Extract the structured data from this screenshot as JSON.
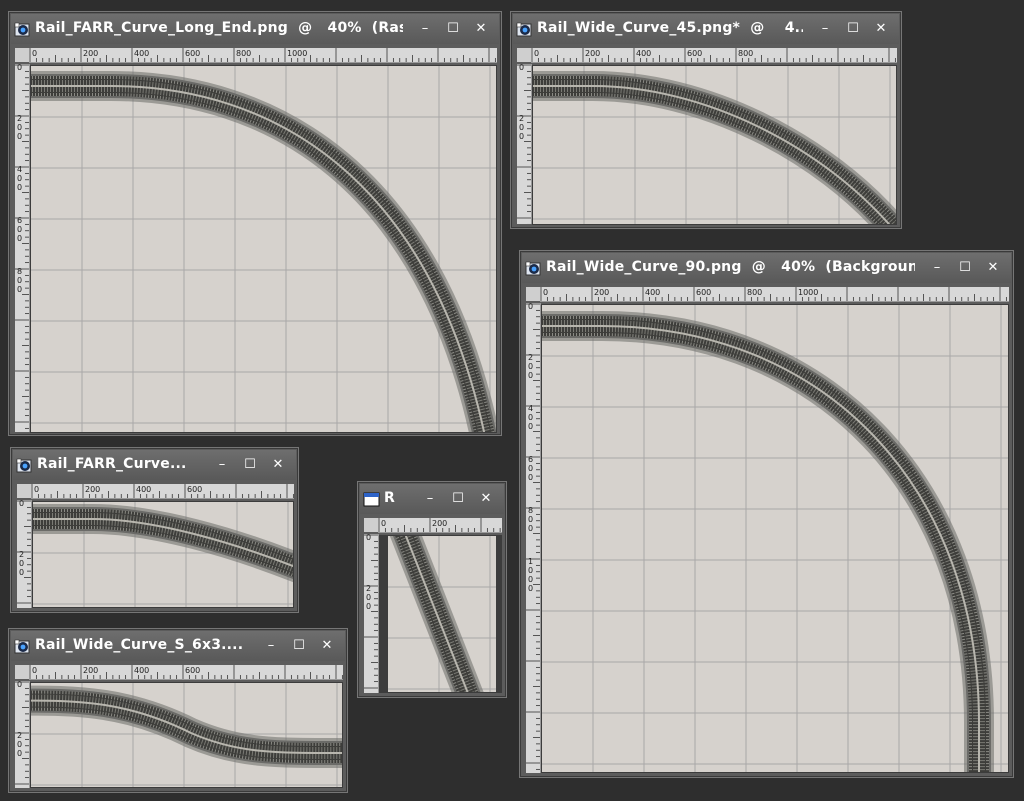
{
  "colors": {
    "desktop": "#2e2e2e",
    "window_frame": "#5c5c5c",
    "canvas": "#d6d2cd",
    "grid": "#a8a8a8",
    "rail_outer": "#6b6b68",
    "rail_inner": "#3d3d3a",
    "rail_center": "#b8b6ae"
  },
  "windows": [
    {
      "id": "farr-long-end",
      "title": "Rail_FARR_Curve_Long_End.png  @   40%  (Ras...",
      "icon": "psp-image-icon",
      "buttons": {
        "minimize": "–",
        "maximize": "☐",
        "close": "✕"
      },
      "ruler_h_labels": [
        "0",
        "200",
        "400",
        "600",
        "800",
        "1000"
      ],
      "ruler_v_labels": [
        "0",
        "200",
        "400",
        "600",
        "800"
      ],
      "track": "quarter-curve"
    },
    {
      "id": "wide-curve-45",
      "title": "Rail_Wide_Curve_45.png*  @    4...",
      "icon": "psp-image-icon",
      "buttons": {
        "minimize": "–",
        "maximize": "☐",
        "close": "✕"
      },
      "ruler_h_labels": [
        "0",
        "200",
        "400",
        "600",
        "800"
      ],
      "ruler_v_labels": [
        "0",
        "200"
      ],
      "track": "curve-45"
    },
    {
      "id": "wide-curve-90",
      "title": "Rail_Wide_Curve_90.png  @   40%  (Backgroun...",
      "icon": "psp-image-icon",
      "buttons": {
        "minimize": "–",
        "maximize": "☐",
        "close": "✕"
      },
      "ruler_h_labels": [
        "0",
        "200",
        "400",
        "600",
        "800",
        "1000"
      ],
      "ruler_v_labels": [
        "0",
        "200",
        "400",
        "600",
        "800",
        "1000"
      ],
      "track": "curve-90"
    },
    {
      "id": "farr-curve",
      "title": "Rail_FARR_Curve...",
      "icon": "psp-image-icon",
      "buttons": {
        "minimize": "–",
        "maximize": "☐",
        "close": "✕"
      },
      "ruler_h_labels": [
        "0",
        "200",
        "400",
        "600"
      ],
      "ruler_v_labels": [
        "0",
        "200"
      ],
      "track": "gentle-curve"
    },
    {
      "id": "r-window",
      "title": "R",
      "icon": "blank-window-icon",
      "buttons": {
        "minimize": "–",
        "maximize": "☐",
        "close": "✕"
      },
      "ruler_h_labels": [
        "0",
        "200"
      ],
      "ruler_v_labels": [
        "0",
        "200"
      ],
      "track": "diagonal"
    },
    {
      "id": "wide-curve-s",
      "title": "Rail_Wide_Curve_S_6x3....",
      "icon": "psp-image-icon",
      "buttons": {
        "minimize": "–",
        "maximize": "☐",
        "close": "✕"
      },
      "ruler_h_labels": [
        "0",
        "200",
        "400",
        "600"
      ],
      "ruler_v_labels": [
        "0",
        "200"
      ],
      "track": "s-curve"
    }
  ]
}
